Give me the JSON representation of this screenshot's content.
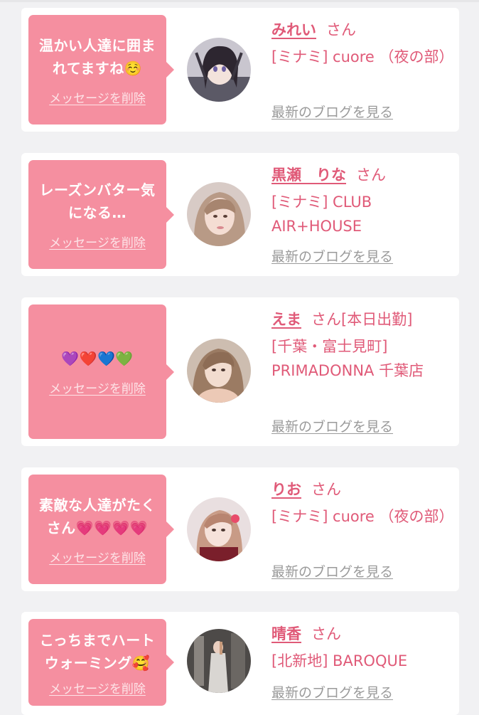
{
  "cards": [
    {
      "message": "温かい人達に囲まれてますね☺️",
      "delete_label": "メッセージを削除",
      "name": "みれい",
      "honorific": "さん",
      "shop": "[ミナミ] cuore （夜の部）",
      "blog_link": "最新のブログを見る"
    },
    {
      "message": "レーズンバター気になる…",
      "delete_label": "メッセージを削除",
      "name": "黒瀬　りな",
      "honorific": "さん",
      "shop": "[ミナミ] CLUB AIR+HOUSE",
      "blog_link": "最新のブログを見る"
    },
    {
      "message": "💜❤️💙💚",
      "delete_label": "メッセージを削除",
      "name": "えま",
      "honorific": "さん[本日出勤]",
      "shop": "[千葉・富士見町] PRIMADONNA 千葉店",
      "blog_link": "最新のブログを見る"
    },
    {
      "message": "素敵な人達がたくさん💗💗💗💗",
      "delete_label": "メッセージを削除",
      "name": "りお",
      "honorific": "さん",
      "shop": "[ミナミ] cuore （夜の部）",
      "blog_link": "最新のブログを見る"
    },
    {
      "message": "こっちまでハートウォーミング🥰",
      "delete_label": "メッセージを削除",
      "name": "晴香",
      "honorific": "さん",
      "shop": "[北新地] BAROQUE",
      "blog_link": "最新のブログを見る"
    }
  ],
  "colors": {
    "bubble": "#f58fa0",
    "name_text": "#e05a78",
    "blog_link": "#9a9a9a",
    "background": "#f1f1f3"
  }
}
